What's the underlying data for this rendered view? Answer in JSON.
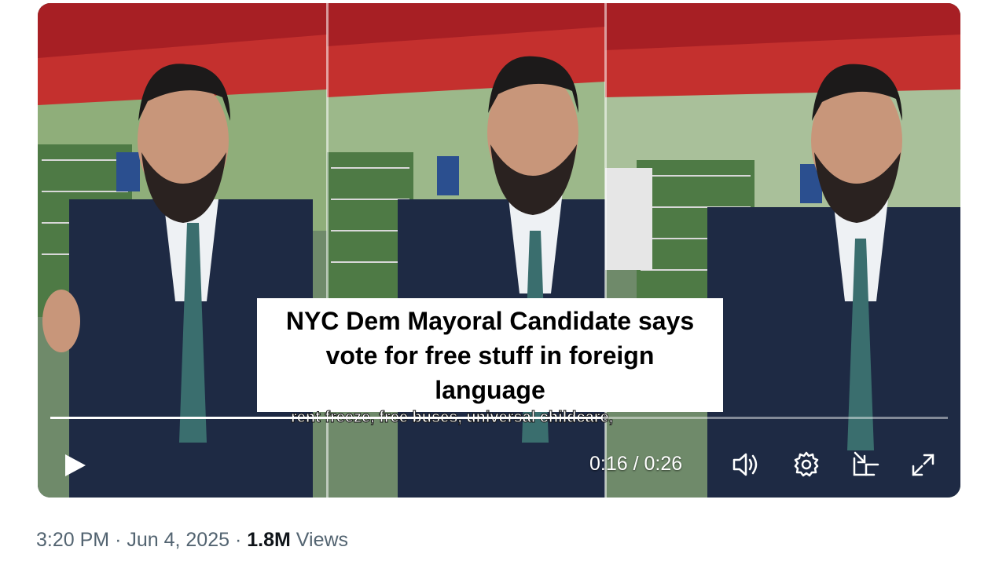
{
  "video": {
    "caption": "NYC Dem Mayoral Candidate says vote for free stuff in foreign language",
    "subtitle": "rent freeze, free buses, universal childcare,",
    "time_current": "0:16",
    "time_total": "0:26",
    "progress": 0.615,
    "controls": {
      "play_icon": "play-icon",
      "volume_icon": "volume-icon",
      "settings_icon": "gear-icon",
      "pip_icon": "picture-in-picture-icon",
      "fullscreen_icon": "fullscreen-icon"
    }
  },
  "meta": {
    "time": "3:20 PM",
    "separator1": "·",
    "date": "Jun 4, 2025",
    "separator2": "·",
    "views_count": "1.8M",
    "views_label": "Views"
  },
  "colors": {
    "awning": "#b5262b",
    "suit": "#1e2a44",
    "tie": "#3a6e6e",
    "meta_text": "#536471"
  }
}
